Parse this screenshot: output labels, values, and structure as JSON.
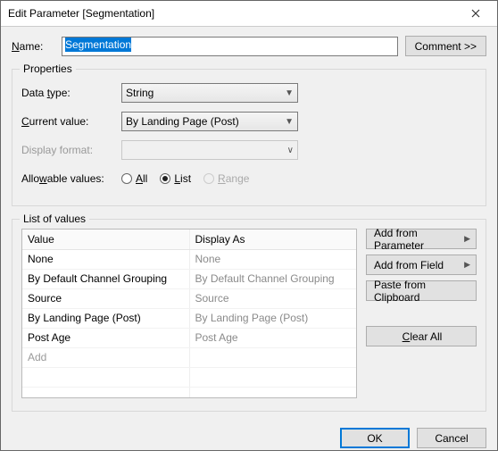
{
  "window": {
    "title": "Edit Parameter [Segmentation]"
  },
  "name": {
    "label": "Name:",
    "value": "Segmentation"
  },
  "comment_btn": "Comment >>",
  "properties": {
    "legend": "Properties",
    "data_type": {
      "label_pre": "Data ",
      "label_acc": "t",
      "label_post": "ype:",
      "value": "String"
    },
    "current_value": {
      "label_pre": "",
      "label_acc": "C",
      "label_post": "urrent value:",
      "value": "By Landing Page (Post)"
    },
    "display_format": {
      "label": "Display format:",
      "value": ""
    },
    "allowable": {
      "label_pre": "Allo",
      "label_acc": "w",
      "label_post": "able values:",
      "all": {
        "pre": "",
        "acc": "A",
        "post": "ll"
      },
      "list": {
        "pre": "",
        "acc": "L",
        "post": "ist"
      },
      "range": {
        "pre": "",
        "acc": "R",
        "post": "ange"
      },
      "selected": "list"
    }
  },
  "lov": {
    "legend": "List of values",
    "headers": {
      "value": "Value",
      "display": "Display As"
    },
    "rows": [
      {
        "value": "None",
        "display": "None"
      },
      {
        "value": "By Default Channel Grouping",
        "display": "By Default Channel Grouping"
      },
      {
        "value": "Source",
        "display": "Source"
      },
      {
        "value": "By Landing Page (Post)",
        "display": "By Landing Page (Post)"
      },
      {
        "value": "Post Age",
        "display": "Post Age"
      }
    ],
    "add_placeholder": "Add",
    "buttons": {
      "add_param": "Add from Parameter",
      "add_field": "Add from Field",
      "paste": "Paste from Clipboard",
      "clear": "Clear All"
    }
  },
  "footer": {
    "ok": "OK",
    "cancel": "Cancel"
  }
}
